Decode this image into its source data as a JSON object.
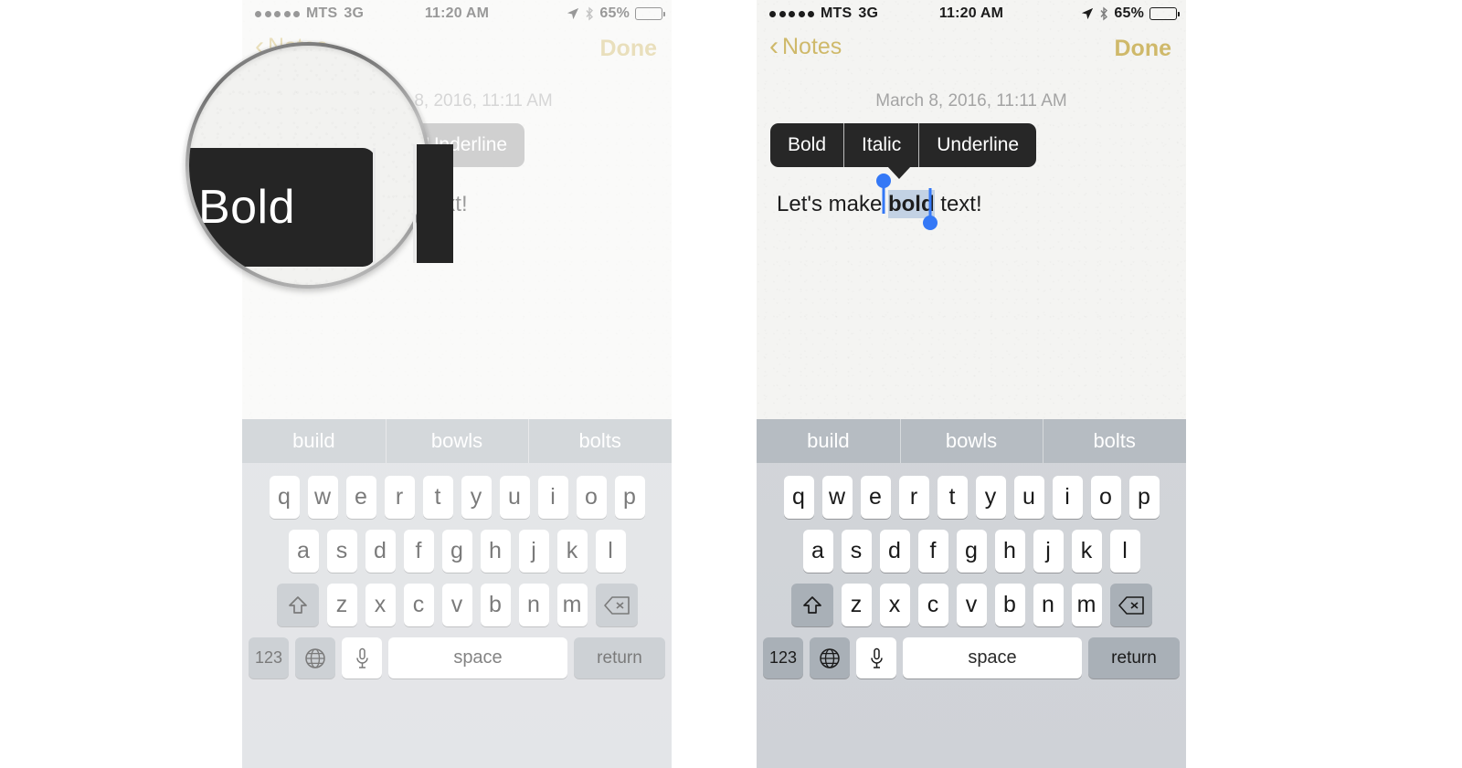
{
  "status_bar": {
    "signal_dots": 5,
    "carrier": "MTS",
    "network": "3G",
    "time": "11:20 AM",
    "battery_percent": "65%",
    "battery_level": 65,
    "icons": [
      "location-arrow-icon",
      "bluetooth-icon",
      "battery-icon"
    ]
  },
  "nav_bar": {
    "back_chevron": "‹",
    "back_label": "Notes",
    "done_label": "Done"
  },
  "note": {
    "date": "March 8, 2016, 11:11 AM",
    "text_before": "Let's make ",
    "text_selected": "bold",
    "text_after": " text!"
  },
  "format_popup": {
    "items": [
      {
        "label": "Bold"
      },
      {
        "label": "Italic"
      },
      {
        "label": "Underline"
      }
    ],
    "background": "#272727",
    "faded_background": "#979797",
    "text_color": "#ffffff",
    "tail_under": "Italic"
  },
  "loupe": {
    "magnified_label": "Bold",
    "target": "bold-menu-item"
  },
  "keyboard": {
    "predictions": [
      "build",
      "bowls",
      "bolts"
    ],
    "row1": [
      "q",
      "w",
      "e",
      "r",
      "t",
      "y",
      "u",
      "i",
      "o",
      "p"
    ],
    "row2": [
      "a",
      "s",
      "d",
      "f",
      "g",
      "h",
      "j",
      "k",
      "l"
    ],
    "row3": [
      "z",
      "x",
      "c",
      "v",
      "b",
      "n",
      "m"
    ],
    "shift_icon": "shift-arrow-icon",
    "backspace_icon": "backspace-icon",
    "numbers_label": "123",
    "globe_icon": "globe-icon",
    "mic_icon": "microphone-icon",
    "space_label": "space",
    "return_label": "return"
  },
  "colors": {
    "accent_gold": "#cfb96a",
    "selection_blue": "#3478f6",
    "selection_highlight": "#c3d2e4",
    "paper": "#f4f4f2",
    "keyboard_bg": "#d2d5d9",
    "predbar_bg": "#b6bcc2",
    "key_white": "#ffffff",
    "key_grey": "#a9b0b7",
    "popup_dark": "#272727"
  }
}
